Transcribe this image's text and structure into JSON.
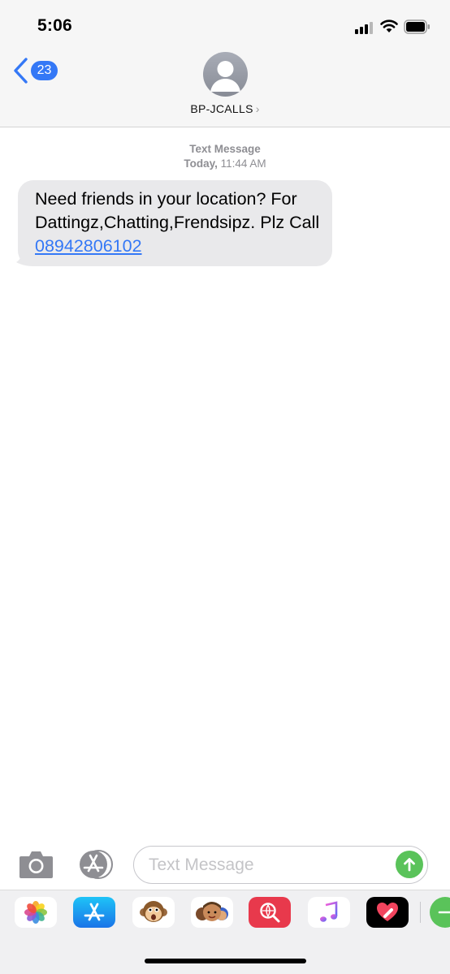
{
  "status_bar": {
    "time": "5:06",
    "signal_icon": "cellular-signal-icon",
    "wifi_icon": "wifi-icon",
    "battery_icon": "battery-icon"
  },
  "header": {
    "back_badge_count": "23",
    "contact_name": "BP-JCALLS",
    "contact_chevron": "›",
    "avatar_icon": "person-silhouette-icon"
  },
  "conversation": {
    "timestamp_label": "Text Message",
    "timestamp_day": "Today,",
    "timestamp_time": "11:44 AM",
    "messages": [
      {
        "direction": "incoming",
        "text": "Need friends in your location? For Dattingz,Chatting,Frendsipz. Plz Call ",
        "link": "08942806102"
      }
    ]
  },
  "compose": {
    "placeholder": "Text Message",
    "value": "",
    "camera_icon": "camera-icon",
    "appstore_icon": "app-store-icon",
    "send_icon": "send-arrow-up-icon"
  },
  "app_drawer": {
    "apps": [
      {
        "name": "Photos",
        "icon": "photos-icon"
      },
      {
        "name": "App Store",
        "icon": "app-store-icon"
      },
      {
        "name": "Animoji",
        "icon": "animoji-monkey-icon"
      },
      {
        "name": "Memoji Stickers",
        "icon": "memoji-icon"
      },
      {
        "name": "Images",
        "icon": "image-search-icon"
      },
      {
        "name": "Music",
        "icon": "music-icon"
      },
      {
        "name": "Digital Touch",
        "icon": "digital-touch-heart-icon"
      }
    ]
  },
  "colors": {
    "accent_blue": "#3478f6",
    "bubble_gray": "#e9e9eb",
    "send_green": "#5ac35a",
    "bar_background": "#f6f6f6"
  }
}
